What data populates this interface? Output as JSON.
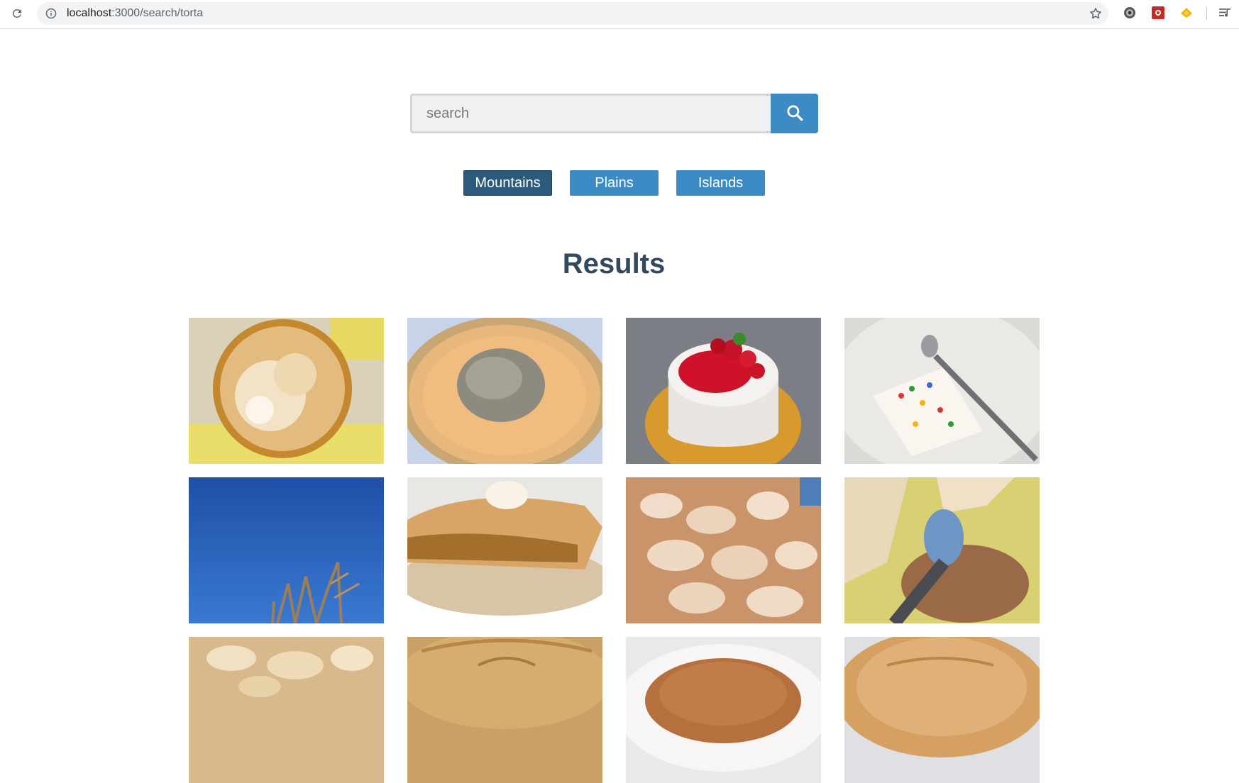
{
  "browser": {
    "url_host": "localhost",
    "url_path": ":3000/search/torta"
  },
  "search": {
    "placeholder": "search",
    "value": ""
  },
  "filters": [
    {
      "label": "Mountains",
      "active": true
    },
    {
      "label": "Plains",
      "active": false
    },
    {
      "label": "Islands",
      "active": false
    }
  ],
  "colors": {
    "primary": "#3d8bc4",
    "active": "#2c5a7c",
    "heading": "#34495e"
  },
  "results": {
    "title": "Results"
  }
}
